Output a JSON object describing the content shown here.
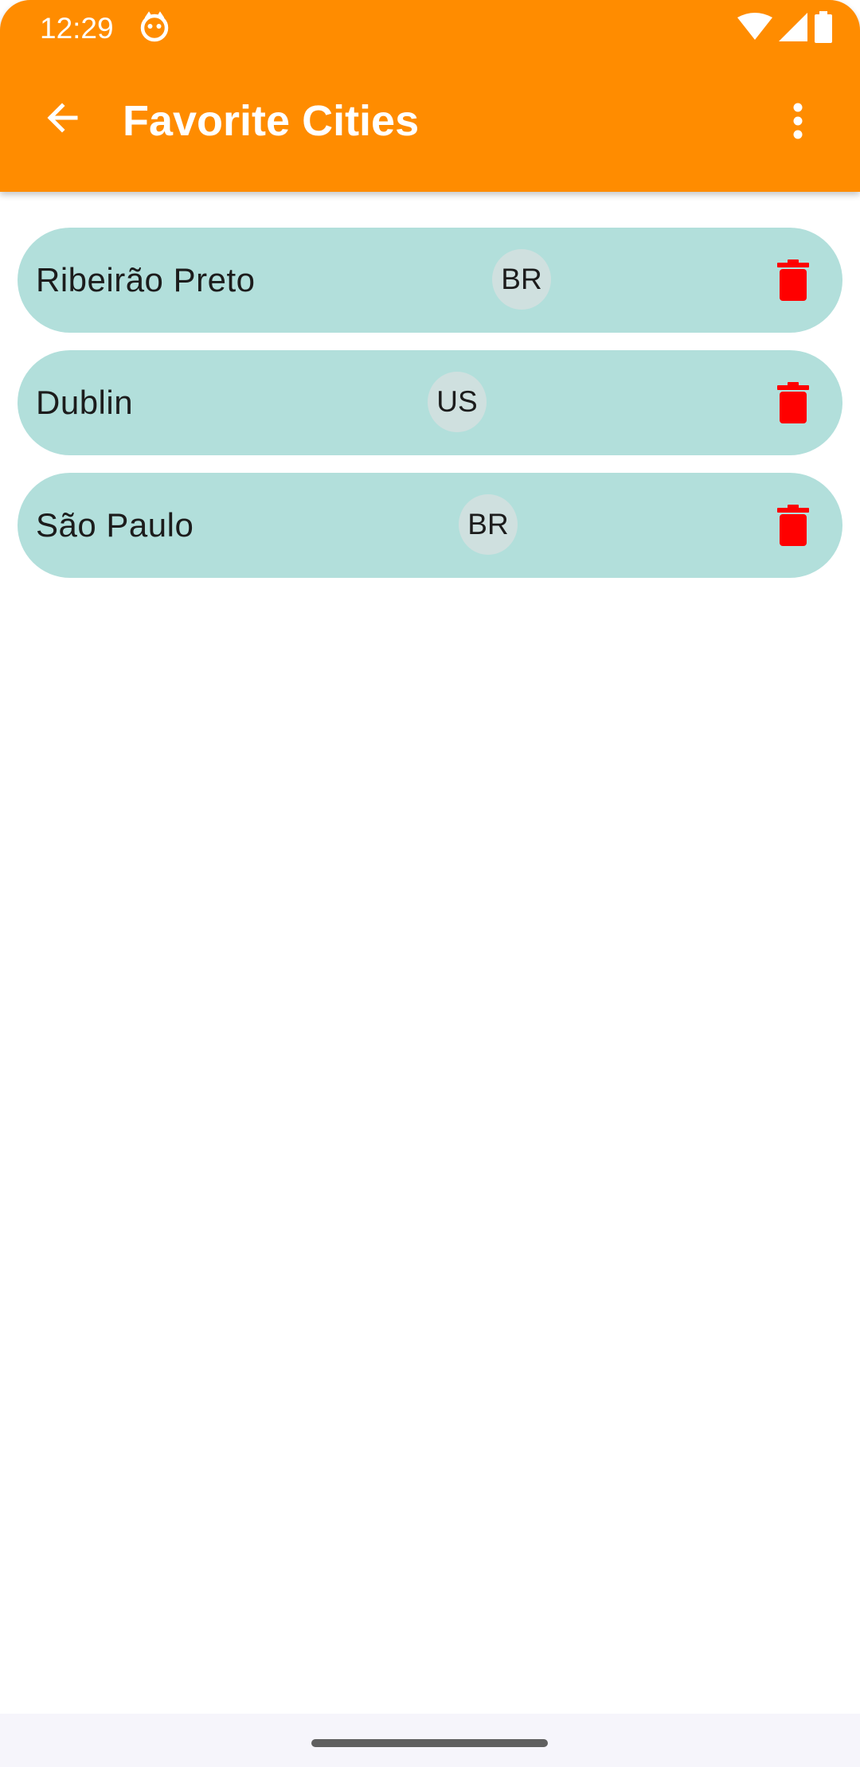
{
  "status_bar": {
    "time": "12:29",
    "icons": [
      "app-notification-icon",
      "wifi-icon",
      "cell-signal-icon",
      "battery-icon"
    ]
  },
  "toolbar": {
    "title": "Favorite Cities",
    "back_icon": "arrow-back-icon",
    "menu_icon": "more-vert-icon",
    "background_color": "#FF8C00"
  },
  "cities": [
    {
      "name": "Ribeirão Preto",
      "country": "BR"
    },
    {
      "name": "Dublin",
      "country": "US"
    },
    {
      "name": "São Paulo",
      "country": "BR"
    }
  ],
  "colors": {
    "card_background": "#B2DFDB",
    "delete_icon": "#FF0000",
    "chip_background": "#CFE0DF"
  }
}
